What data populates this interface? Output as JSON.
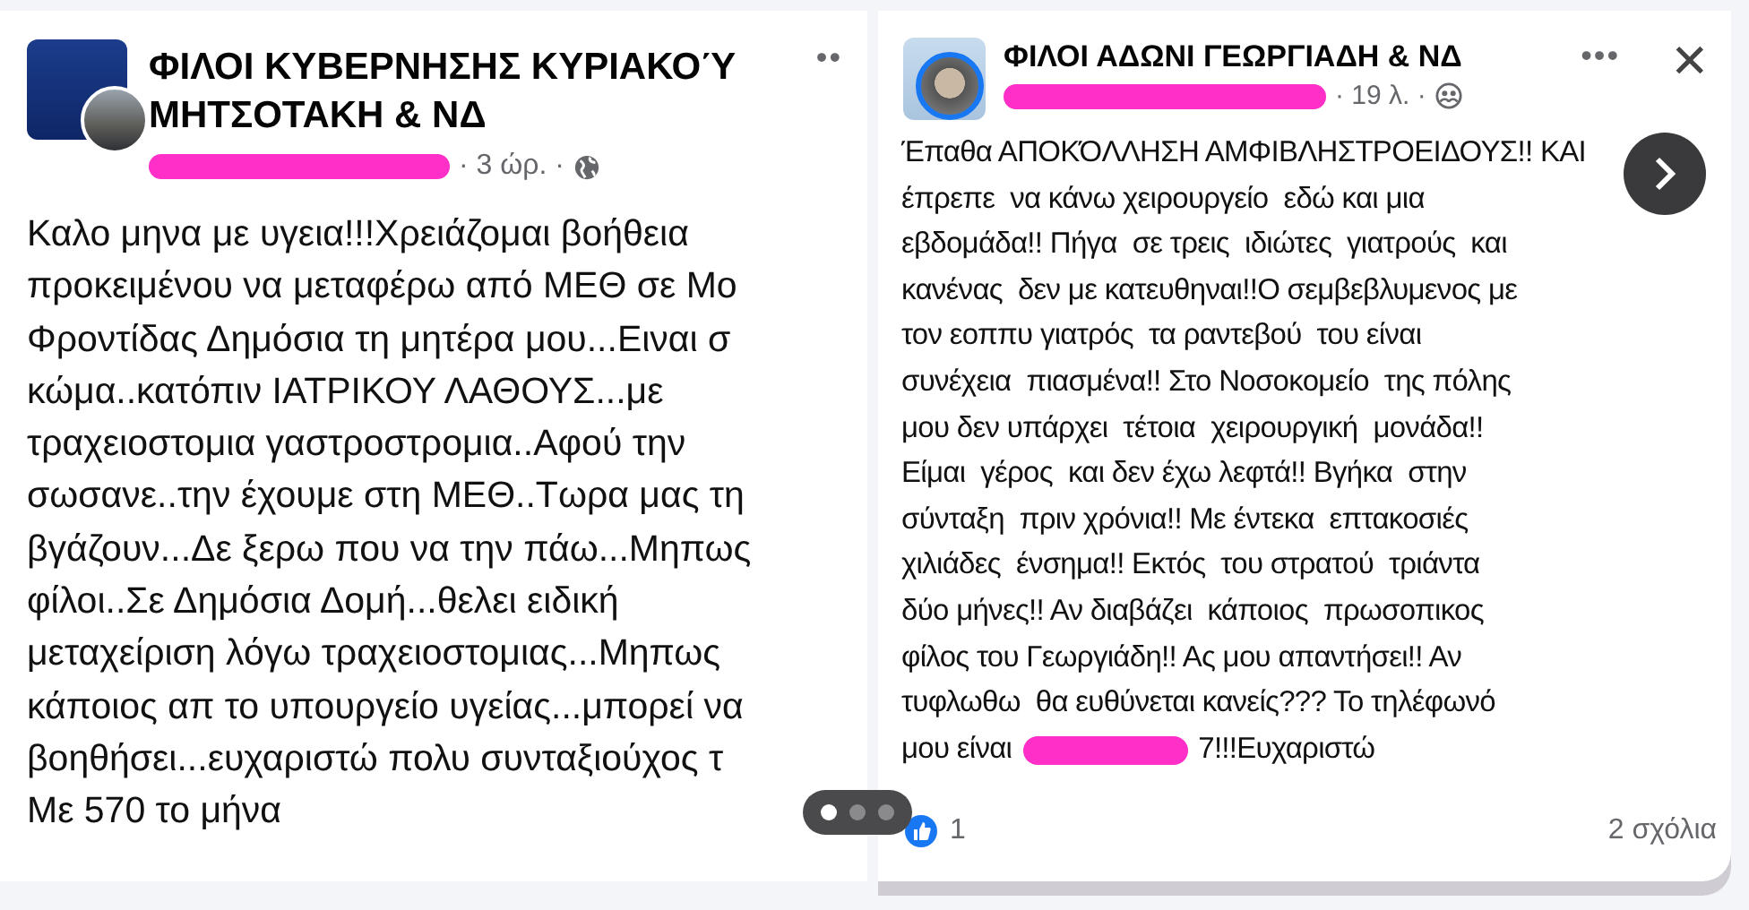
{
  "posts": [
    {
      "page_name": "ΦΙΛΟΙ ΚΥΒΕΡΝΗΣΗΣ ΚΥΡΙΑΚΟΎ ΜΗΤΣΟΤΑΚΗ & ΝΔ",
      "time": "· 3 ώρ. ·",
      "privacy": {
        "kind": "public"
      },
      "more": "••",
      "text_lines": [
        "Καλο μηνα με υγεια!!!Χρειάζομαι βοήθεια",
        "προκειμένου να μεταφέρω από ΜΕΘ σε Μο",
        "Φροντίδας Δημόσια τη μητέρα μου...Ειναι σ",
        "κώμα..κατόπιν ΙΑΤΡΙΚΟΥ ΛΑΘΟΥΣ...με",
        "τραχειοστομια γαστροστρομια..Αφού την",
        "σωσανε..την έχουμε στη ΜΕΘ..Τωρα μας τη",
        "βγάζουν...Δε ξερω που να την πάω...Μηπως",
        "φίλοι..Σε Δημόσια Δομή...θελει ειδική",
        "μεταχείριση λόγω τραχειοστομιας...Μηπως",
        "κάποιος απ το υπουργείο υγείας...μπορεί να",
        "βοηθήσει...ευχαριστώ πολυ συνταξιούχος τ",
        "Με 570 το μήνα"
      ]
    },
    {
      "page_name": "ΦΙΛΟΙ ΑΔΩΝΙ ΓΕΩΡΓΙΑΔΗ & ΝΔ",
      "time": "· 19 λ. ·",
      "privacy": {
        "kind": "friends"
      },
      "more": "•••",
      "close": "✕",
      "text_lines": [
        "Έπαθα ΑΠΟΚΌΛΛΗΣΗ ΑΜΦΙΒΛΗΣΤΡΟΕΙΔΟΥΣ!! ΚΑΙ",
        "έπρεπε  να κάνω χειρουργείο  εδώ και μια",
        "εβδομάδα!! Πήγα  σε τρεις  ιδιώτες  γιατρούς  και",
        "κανένας  δεν με κατευθηναι!!Ο σεμβεβλυμενος με",
        "τον εοππυ γιατρός  τα ραντεβού  του είναι",
        "συνέχεια  πιασμένα!! Στο Νοσοκομείο  της πόλης",
        "μου δεν υπάρχει  τέτοια  χειρουργική  μονάδα!!",
        "Είμαι  γέρος  και δεν έχω λεφτά!! Βγήκα  στην",
        "σύνταξη  πριν χρόνια!! Με έντεκα  επτακοσιές",
        "χιλιάδες  ένσημα!! Εκτός  του στρατού  τριάντα",
        "δύο μήνες!! Αν διαβάζει  κάποιος  πρωσοπικος",
        "φίλος του Γεωργιάδη!! Ας μου απαντήσει!! Αν",
        "τυφλωθω  θα ευθύνεται κανείς??? Το τηλέφωνό"
      ],
      "last_line": {
        "before": "μου είναι",
        "after": "7!!!Ευχαριστώ"
      },
      "reactions": "1",
      "comments": "2 σχόλια"
    }
  ],
  "carousel": {
    "dots": [
      {
        "selected": true
      },
      {
        "selected": false
      },
      {
        "selected": false
      }
    ]
  }
}
